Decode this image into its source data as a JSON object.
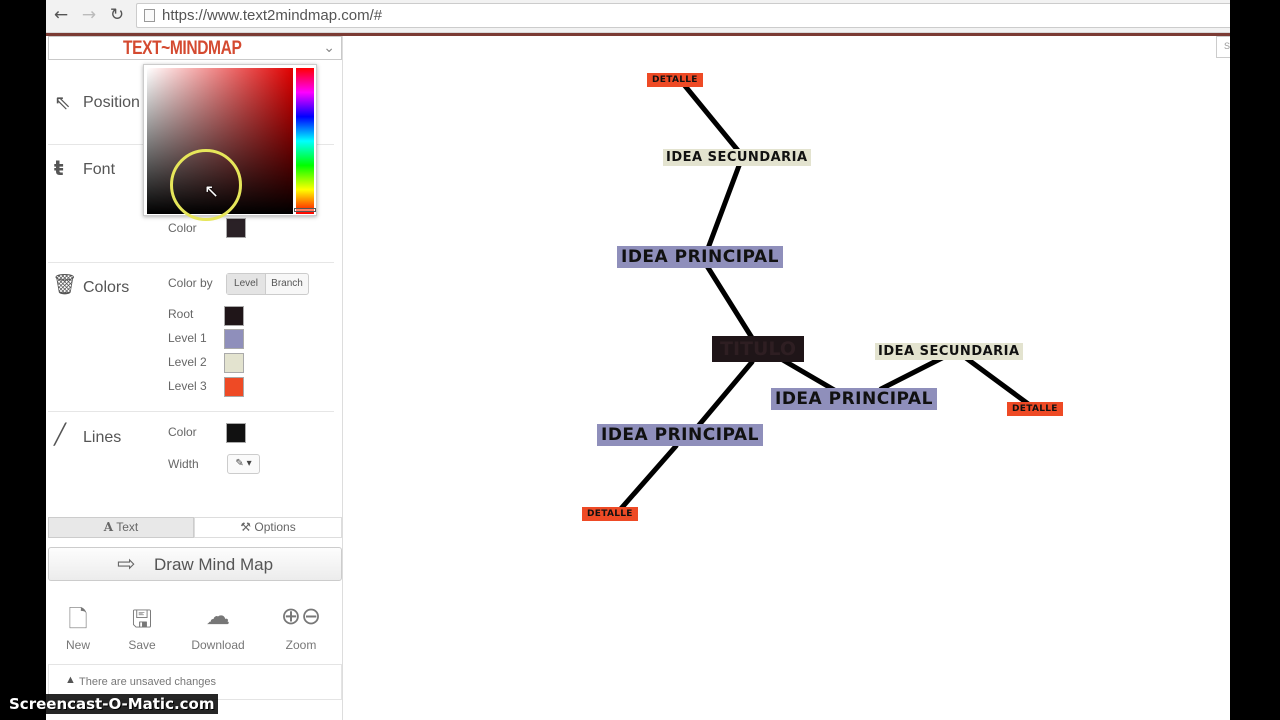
{
  "browser": {
    "back_icon": "←",
    "forward_icon": "→",
    "reload_icon": "↻",
    "url": "https://www.text2mindmap.com/#"
  },
  "app": {
    "logo": "TEXT~MINDMAP",
    "right_tab_text": "S"
  },
  "sidebar": {
    "position_label": "Position",
    "font_label": "Font",
    "font_color_label": "Color",
    "font_color": "#2a2126",
    "colors_label": "Colors",
    "color_by_label": "Color by",
    "color_by_options": [
      "Level",
      "Branch"
    ],
    "color_by_selected": "Level",
    "levels": [
      {
        "label": "Root",
        "color": "#1f1518"
      },
      {
        "label": "Level 1",
        "color": "#8f8fbb"
      },
      {
        "label": "Level 2",
        "color": "#e3e3cf"
      },
      {
        "label": "Level 3",
        "color": "#ee4a25"
      }
    ],
    "lines_label": "Lines",
    "lines_color_label": "Color",
    "lines_color": "#111111",
    "lines_width_label": "Width",
    "lines_width_value": "✎ ▾",
    "tabs": [
      "Text",
      "Options"
    ],
    "tab_text_icon": "A",
    "tab_options_icon": "🔧",
    "draw_button": "Draw Mind Map",
    "tools": [
      {
        "label": "New",
        "icon": "file-icon"
      },
      {
        "label": "Save",
        "icon": "save-icon"
      },
      {
        "label": "Download",
        "icon": "download-icon"
      },
      {
        "label": "Zoom",
        "icon": "zoom-icon"
      }
    ],
    "unsaved_message": "There are unsaved changes"
  },
  "color_picker": {
    "open": true
  },
  "mindmap": {
    "root": "TITULO",
    "nodes": {
      "detalle_top": "DETALLE",
      "secundaria_top": "IDEA SECUNDARIA",
      "principal_top": "IDEA PRINCIPAL",
      "principal_right": "IDEA PRINCIPAL",
      "secundaria_right": "IDEA SECUNDARIA",
      "detalle_right": "DETALLE",
      "principal_bottom": "IDEA PRINCIPAL",
      "detalle_bottom": "DETALLE"
    }
  },
  "watermark": "Screencast-O-Matic.com"
}
